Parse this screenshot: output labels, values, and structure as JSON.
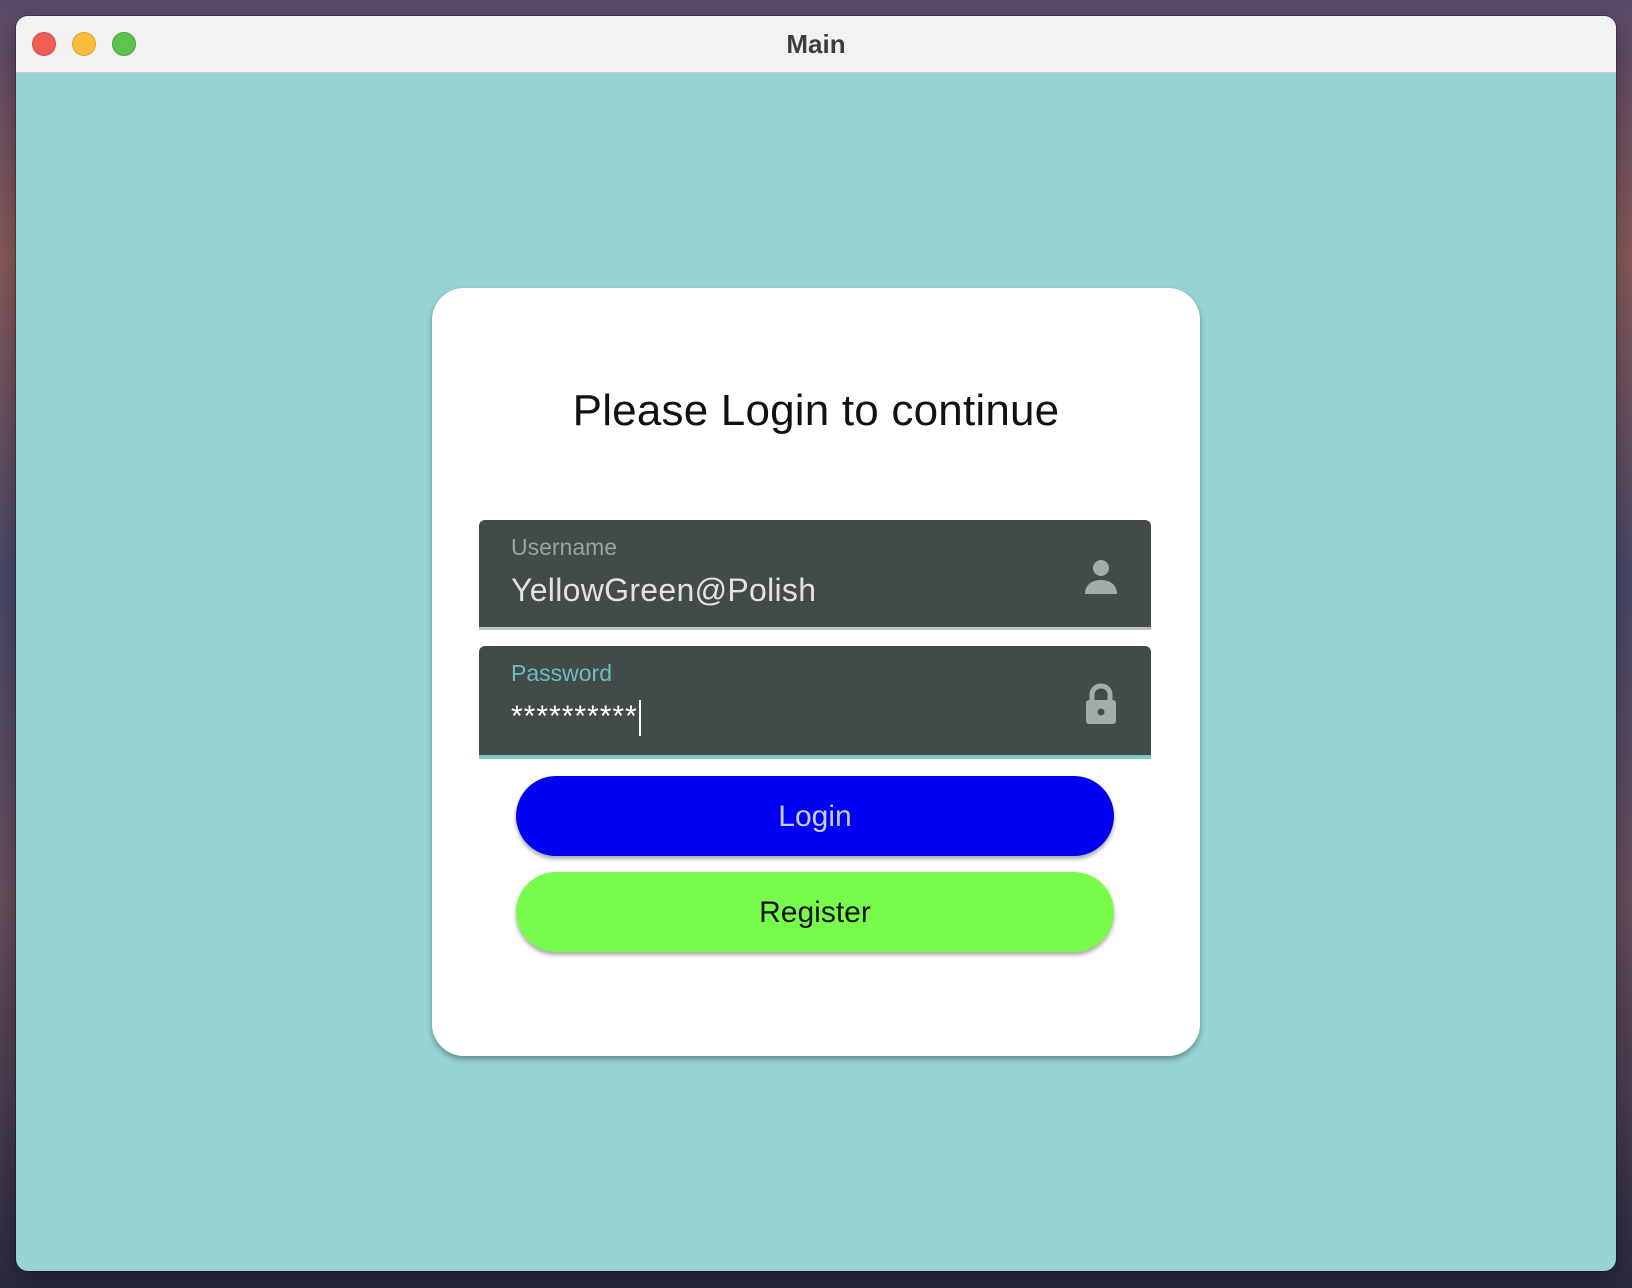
{
  "window": {
    "title": "Main"
  },
  "login": {
    "heading": "Please Login to continue",
    "username": {
      "label": "Username",
      "value": "YellowGreen@Polish",
      "icon": "person-icon"
    },
    "password": {
      "label": "Password",
      "value": "**********",
      "icon": "lock-icon"
    },
    "login_button": "Login",
    "register_button": "Register"
  },
  "colors": {
    "window_background": "#96d3d3",
    "field_background": "#424a4a",
    "login_button": "#0000f5",
    "register_button": "#78fc4b",
    "focus_accent": "#7fc8c8"
  }
}
